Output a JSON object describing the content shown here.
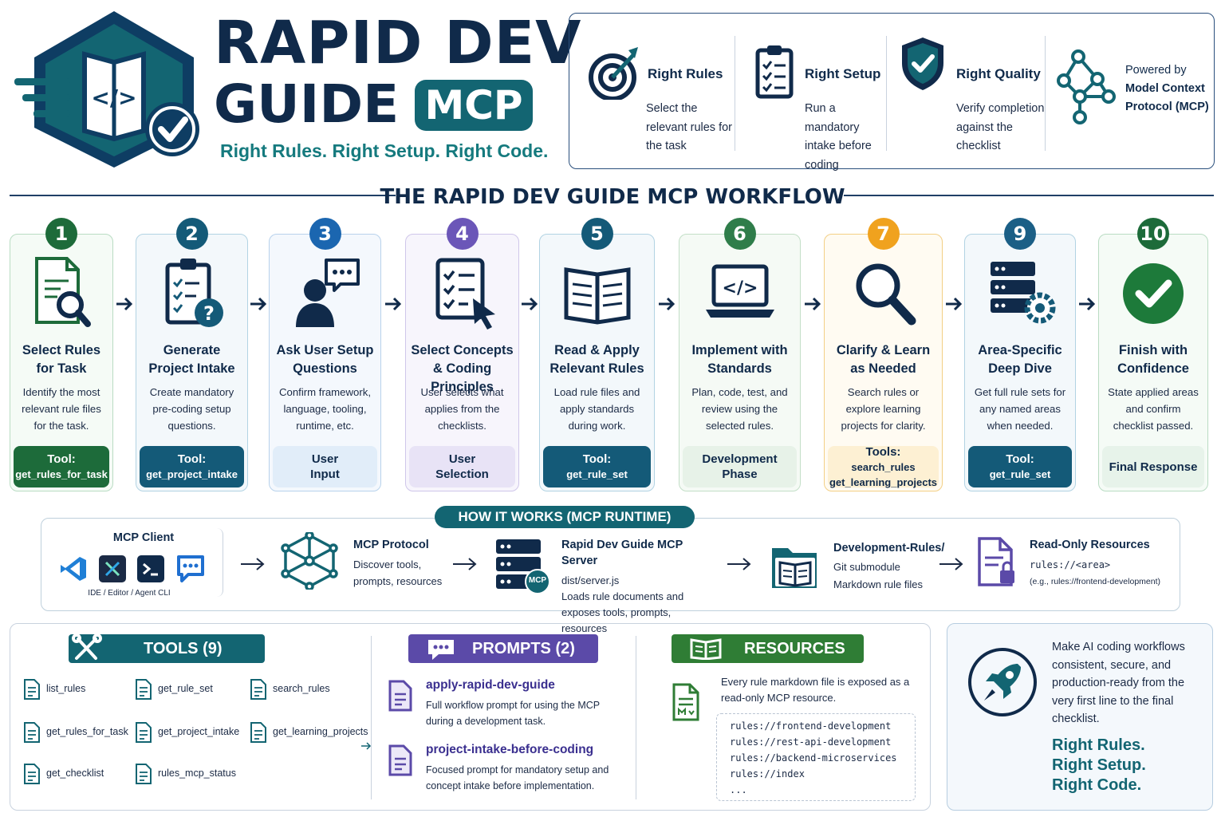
{
  "header": {
    "title_line1": "RAPID DEV",
    "title_line2": "GUIDE",
    "badge": "MCP",
    "tagline": "Right Rules. Right Setup. Right Code.",
    "features": [
      {
        "title": "Right Rules",
        "desc": "Select the relevant rules for the task"
      },
      {
        "title": "Right Setup",
        "desc": "Run a mandatory intake before coding"
      },
      {
        "title": "Right Quality",
        "desc": "Verify completion against the checklist"
      }
    ],
    "powered_line1": "Powered by",
    "powered_line2": "Model Context Protocol (MCP)"
  },
  "workflow": {
    "title": "THE RAPID DEV GUIDE MCP WORKFLOW",
    "steps": [
      {
        "num": "1",
        "title": "Select Rules for Task",
        "desc": "Identify the most relevant rule files for the task.",
        "foot1": "Tool:",
        "foot2": "get_rules_for_task",
        "color": "#1d6b3a"
      },
      {
        "num": "2",
        "title": "Generate Project Intake",
        "desc": "Create mandatory pre-coding setup questions.",
        "foot1": "Tool:",
        "foot2": "get_project_intake",
        "color": "#145a78"
      },
      {
        "num": "3",
        "title": "Ask User Setup Questions",
        "desc": "Confirm framework, language, tooling, runtime, etc.",
        "foot1": "User",
        "foot2": "Input",
        "color": "#1b66b0"
      },
      {
        "num": "4",
        "title": "Select Concepts & Coding Principles",
        "desc": "User selects what applies from the checklists.",
        "foot1": "User",
        "foot2": "Selection",
        "color": "#6b56b8"
      },
      {
        "num": "5",
        "title": "Read & Apply Relevant Rules",
        "desc": "Load rule files and apply standards during work.",
        "foot1": "Tool:",
        "foot2": "get_rule_set",
        "color": "#145a78"
      },
      {
        "num": "6",
        "title": "Implement with Standards",
        "desc": "Plan, code, test, and review using the selected rules.",
        "foot1": "Development",
        "foot2": "Phase",
        "color": "#2f7d4a"
      },
      {
        "num": "7",
        "title": "Clarify & Learn as Needed",
        "desc": "Search rules or explore learning projects for clarity.",
        "foot1": "Tools:",
        "foot2": "search_rules",
        "foot3": "get_learning_projects",
        "color": "#f0a21e"
      },
      {
        "num": "9",
        "title": "Area-Specific Deep Dive",
        "desc": "Get full rule sets for any named areas when needed.",
        "foot1": "Tool:",
        "foot2": "get_rule_set",
        "color": "#1b5f86"
      },
      {
        "num": "10",
        "title": "Finish with Confidence",
        "desc": "State applied areas and confirm checklist passed.",
        "foot1": "Final Response",
        "foot2": "",
        "color": "#1d6b3a"
      }
    ]
  },
  "runtime": {
    "title": "HOW IT WORKS (MCP RUNTIME)",
    "client_title": "MCP Client",
    "client_sub": "IDE / Editor / Agent CLI",
    "protocol_title": "MCP Protocol",
    "protocol_desc": "Discover tools, prompts, resources",
    "server_title": "Rapid Dev Guide MCP Server",
    "server_file": "dist/server.js",
    "server_desc": "Loads rule documents and exposes tools, prompts, resources",
    "server_badge": "MCP",
    "rules_title": "Development-Rules/",
    "rules_l1": "Git submodule",
    "rules_l2": "Markdown rule files",
    "ro_title": "Read-Only Resources",
    "ro_uri": "rules://<area>",
    "ro_example": "(e.g., rules://frontend-development)"
  },
  "tools": {
    "title": "TOOLS (9)",
    "items": [
      "list_rules",
      "get_rule_set",
      "search_rules",
      "get_rules_for_task",
      "get_project_intake",
      "get_learning_projects",
      "get_checklist",
      "rules_mcp_status"
    ]
  },
  "prompts": {
    "title": "PROMPTS (2)",
    "items": [
      {
        "name": "apply-rapid-dev-guide",
        "desc1": "Full workflow prompt for using the MCP",
        "desc2": "during a development task."
      },
      {
        "name": "project-intake-before-coding",
        "desc1": "Focused prompt for mandatory setup and",
        "desc2": "concept intake before implementation."
      }
    ]
  },
  "resources": {
    "title": "RESOURCES",
    "desc": "Every rule markdown file is exposed as a read-only MCP resource.",
    "uris": [
      "rules://frontend-development",
      "rules://rest-api-development",
      "rules://backend-microservices",
      "rules://index",
      "..."
    ]
  },
  "cta": {
    "text": "Make AI coding workflows consistent, secure, and production-ready from the very first line to the final checklist.",
    "line1": "Right Rules.",
    "line2": "Right Setup.",
    "line3": "Right Code."
  }
}
